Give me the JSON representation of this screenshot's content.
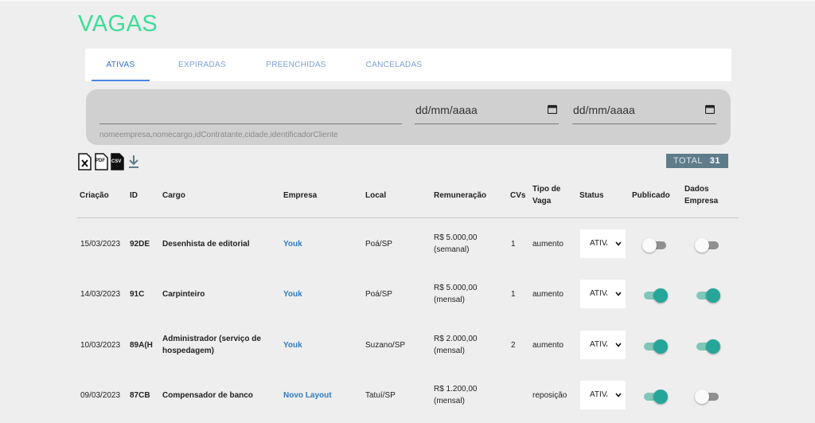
{
  "page": {
    "title": "VAGAS"
  },
  "tabs": [
    {
      "label": "ATIVAS",
      "active": true
    },
    {
      "label": "EXPIRADAS",
      "active": false
    },
    {
      "label": "PREENCHIDAS",
      "active": false
    },
    {
      "label": "CANCELADAS",
      "active": false
    }
  ],
  "filter": {
    "search_value": "",
    "search_hint": "nomeempresa,nomecargo,idContratante,cidade,identificadorCliente",
    "date_from": "dd/mm/aaaa",
    "date_to": "dd/mm/aaaa"
  },
  "export": {
    "xls_icon": "excel-file-icon",
    "pdf_label": "PDF",
    "csv_label": "CSV",
    "download_icon": "download-icon"
  },
  "total": {
    "label": "TOTAL",
    "value": "31"
  },
  "table": {
    "headers": {
      "criacao": "Criação",
      "id": "ID",
      "cargo": "Cargo",
      "empresa": "Empresa",
      "local": "Local",
      "remuneracao": "Remuneração",
      "cvs": "CVs",
      "tipo": "Tipo de Vaga",
      "status": "Status",
      "publicado": "Publicado",
      "dados": "Dados Empresa"
    },
    "rows": [
      {
        "criacao": "15/03/2023",
        "id": "92DE",
        "cargo": "Desenhista de editorial",
        "empresa": "Youk",
        "local": "Poá/SP",
        "remuneracao": "R$ 5.000,00 (semanal)",
        "cvs": "1",
        "tipo": "aumento",
        "status": "ATIVA",
        "publicado": false,
        "dados_empresa": false
      },
      {
        "criacao": "14/03/2023",
        "id": "91C",
        "cargo": "Carpinteiro",
        "empresa": "Youk",
        "local": "Poá/SP",
        "remuneracao": "R$ 5.000,00 (mensal)",
        "cvs": "1",
        "tipo": "aumento",
        "status": "ATIVA",
        "publicado": true,
        "dados_empresa": true
      },
      {
        "criacao": "10/03/2023",
        "id": "89A(H",
        "cargo": "Administrador (serviço de hospedagem)",
        "empresa": "Youk",
        "local": "Suzano/SP",
        "remuneracao": "R$ 2.000,00 (mensal)",
        "cvs": "2",
        "tipo": "aumento",
        "status": "ATIVA",
        "publicado": true,
        "dados_empresa": true
      },
      {
        "criacao": "09/03/2023",
        "id": "87CB",
        "cargo": "Compensador de banco",
        "empresa": "Novo Layout",
        "local": "Tatuí/SP",
        "remuneracao": "R$ 1.200,00 (mensal)",
        "cvs": "",
        "tipo": "reposição",
        "status": "ATIVA",
        "publicado": true,
        "dados_empresa": false
      }
    ]
  },
  "colors": {
    "accent": "#3ddc97",
    "tab_active": "#2f6fcf",
    "toggle_on": "#26a69a",
    "link": "#2f7bbf",
    "total_bg": "#5f7c8a"
  }
}
